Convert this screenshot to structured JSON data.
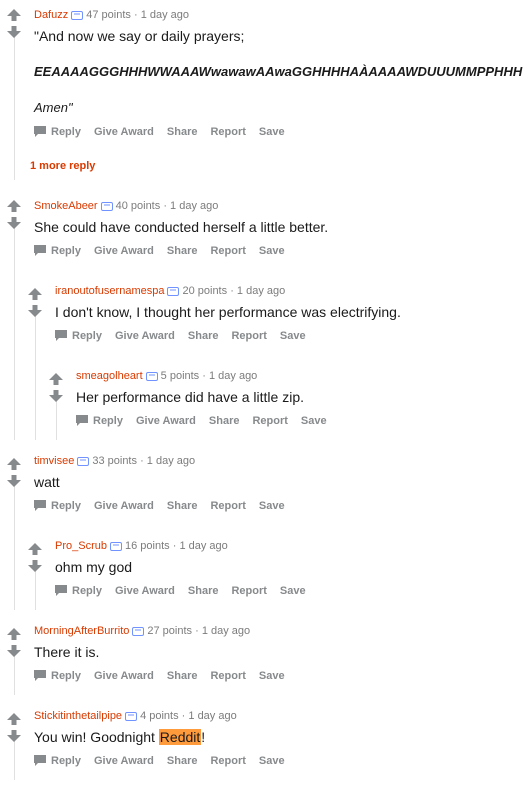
{
  "comments": [
    {
      "author": "Dafuzz",
      "points": "47 points",
      "time": "1 day ago",
      "line1": "\"And now we say or daily prayers;",
      "line2": "EEAAAAGGGHHHWWAAAWwawawAAwaGGHHHHAÀAAAAWDUUUMMPPHHH",
      "line3": "Amen\"",
      "more": "1 more reply"
    },
    {
      "author": "SmokeAbeer",
      "points": "40 points",
      "time": "1 day ago",
      "text": "She could have conducted herself a little better."
    },
    {
      "author": "iranoutofusernamespa",
      "points": "20 points",
      "time": "1 day ago",
      "text": "I don't know, I thought her performance was electrifying."
    },
    {
      "author": "smeagolheart",
      "points": "5 points",
      "time": "1 day ago",
      "text": "Her performance did have a little zip."
    },
    {
      "author": "timvisee",
      "points": "33 points",
      "time": "1 day ago",
      "text": "watt"
    },
    {
      "author": "Pro_Scrub",
      "points": "16 points",
      "time": "1 day ago",
      "text": "ohm my god"
    },
    {
      "author": "MorningAfterBurrito",
      "points": "27 points",
      "time": "1 day ago",
      "text": "There it is."
    },
    {
      "author": "Stickitinthetailpipe",
      "points": "4 points",
      "time": "1 day ago",
      "text_before": "You win! Goodnight ",
      "text_highlight": "Reddit",
      "text_after": "!"
    }
  ],
  "actions": {
    "reply": "Reply",
    "give_award": "Give Award",
    "share": "Share",
    "report": "Report",
    "save": "Save"
  },
  "separator": "·",
  "colors": {
    "author": "#d93a00",
    "highlight": "#ff9b3a",
    "arrow": "#878a8c"
  }
}
